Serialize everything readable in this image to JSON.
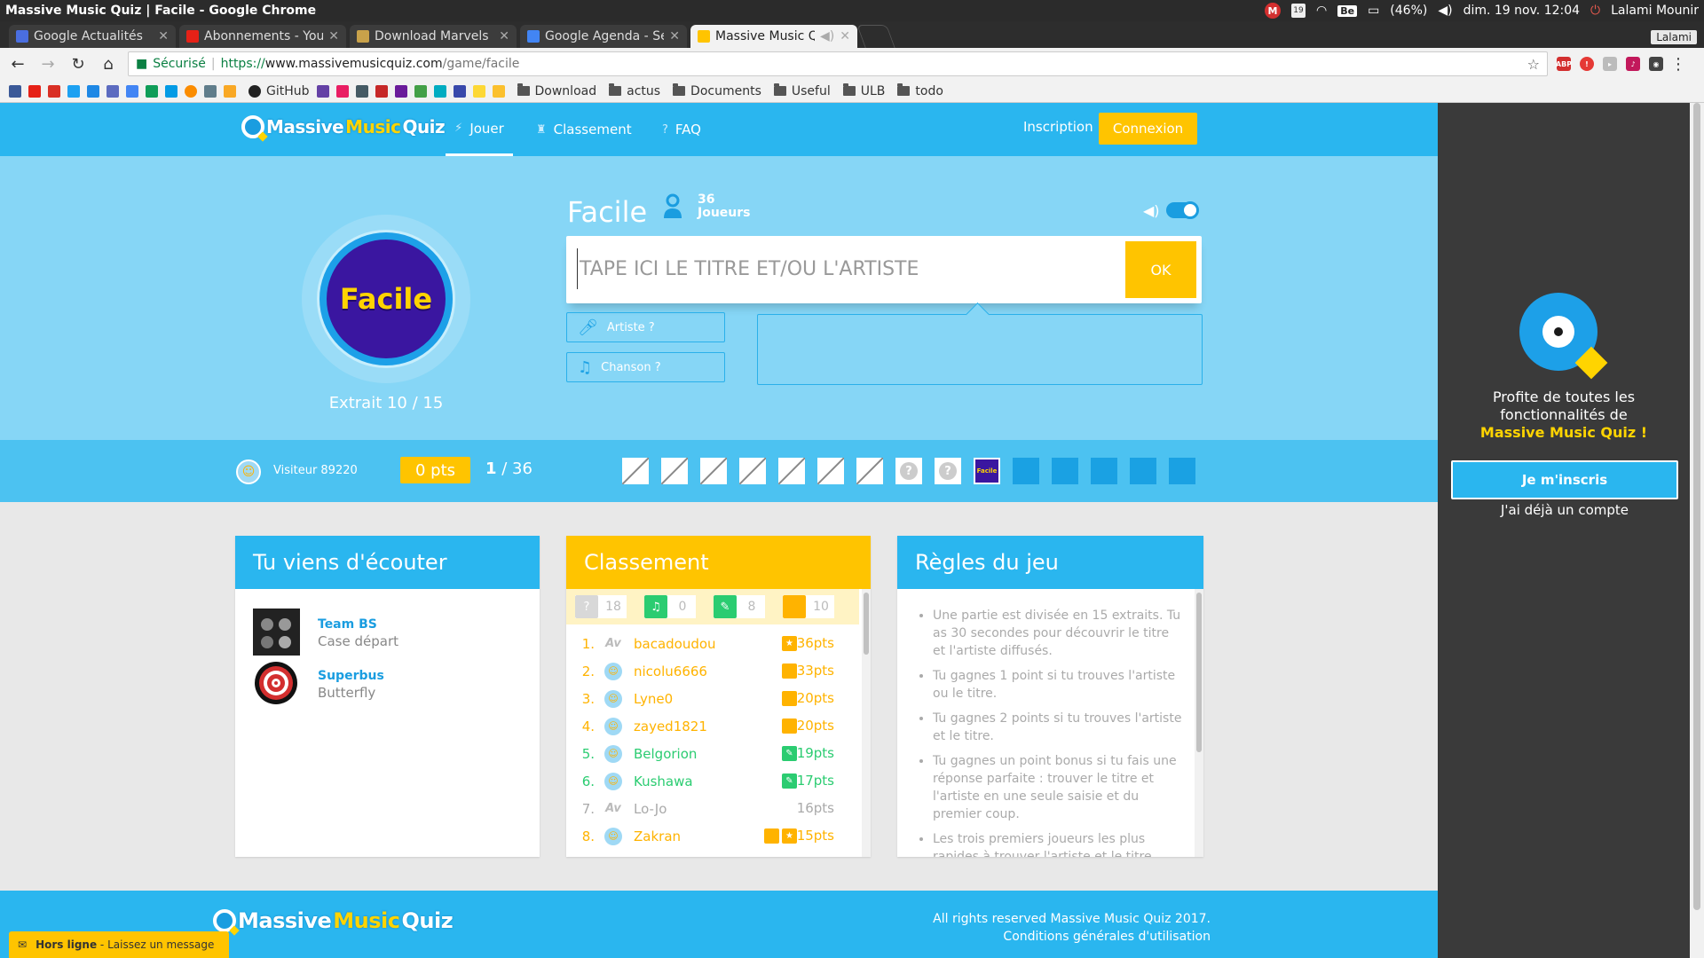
{
  "os_bar": {
    "window_title": "Massive Music Quiz | Facile - Google Chrome",
    "mail_badge": "M",
    "calendar_day": "19",
    "keyboard_layout": "Be",
    "battery": "(46%)",
    "clock": "dim. 19 nov. 12:04",
    "user": "Lalami Mounir"
  },
  "tabs": [
    {
      "label": "Google Actualités",
      "icon": "google-news-icon",
      "color": "#4a6ee0"
    },
    {
      "label": "Abonnements - You",
      "icon": "youtube-icon",
      "color": "#e62117"
    },
    {
      "label": "Download Marvels",
      "icon": "shield-icon",
      "color": "#c9a24a"
    },
    {
      "label": "Google Agenda - Se",
      "icon": "calendar-icon",
      "color": "#4285f4"
    },
    {
      "label": "Massive Music Q",
      "icon": "mmq-icon",
      "color": "#ffc400",
      "active": true
    }
  ],
  "profile_name": "Lalami",
  "address": {
    "secure_label": "Sécurisé",
    "protocol": "https://",
    "host": "www.massivemusicquiz.com",
    "path": "/game/facile"
  },
  "bookmarks": {
    "github_label": "GitHub",
    "folders": [
      "Download",
      "actus",
      "Documents",
      "Useful",
      "ULB",
      "todo"
    ]
  },
  "site_nav": {
    "play": "Jouer",
    "ranking": "Classement",
    "faq": "FAQ",
    "signup": "Inscription",
    "login": "Connexion"
  },
  "logo": {
    "part1": "Massive",
    "part2": "Music",
    "part3": "Quiz"
  },
  "game": {
    "level": "Facile",
    "level_badge": "Facile",
    "extract_label": "Extrait 10 / 15",
    "players_count": "36",
    "players_label": "Joueurs",
    "answer_placeholder": "TAPE ICI LE TITRE ET/OU L'ARTISTE",
    "ok_label": "OK",
    "artist_hint": "Artiste ?",
    "song_hint": "Chanson ?",
    "sound_on": true
  },
  "score_bar": {
    "visitor_name": "Visiteur 89220",
    "points": "0 pts",
    "rank_current": "1",
    "rank_total": "/ 36",
    "extracts": [
      "done",
      "done",
      "done",
      "done",
      "done",
      "done",
      "done",
      "unknown",
      "unknown",
      "current",
      "todo",
      "todo",
      "todo",
      "todo",
      "todo"
    ],
    "current_label": "Facile"
  },
  "listen_card": {
    "title": "Tu viens d'écouter",
    "songs": [
      {
        "artist": "Team BS",
        "title": "Case départ"
      },
      {
        "artist": "Superbus",
        "title": "Butterfly"
      }
    ]
  },
  "ranking_card": {
    "title": "Classement",
    "stats": [
      {
        "icon": "question-icon",
        "value": "18",
        "color": "#d8d8d8"
      },
      {
        "icon": "music-note-icon",
        "value": "0",
        "color": "#2bcc71"
      },
      {
        "icon": "microphone-icon",
        "value": "8",
        "color": "#2bcc71"
      },
      {
        "icon": "square-icon",
        "value": "10",
        "color": "#ffb300"
      }
    ],
    "rows": [
      {
        "rank": "1.",
        "name": "bacadoudou",
        "pts": "36pts",
        "color": "orange",
        "avatar": "Av",
        "badges": [
          "star"
        ]
      },
      {
        "rank": "2.",
        "name": "nicolu6666",
        "pts": "33pts",
        "color": "orange",
        "avatar": "face",
        "badges": [
          "square"
        ]
      },
      {
        "rank": "3.",
        "name": "Lyne0",
        "pts": "20pts",
        "color": "orange",
        "avatar": "face",
        "badges": [
          "square"
        ]
      },
      {
        "rank": "4.",
        "name": "zayed1821",
        "pts": "20pts",
        "color": "orange",
        "avatar": "face",
        "badges": [
          "square"
        ]
      },
      {
        "rank": "5.",
        "name": "Belgorion",
        "pts": "19pts",
        "color": "green",
        "avatar": "face",
        "badges": [
          "mic"
        ]
      },
      {
        "rank": "6.",
        "name": "Kushawa",
        "pts": "17pts",
        "color": "green",
        "avatar": "face",
        "badges": [
          "mic"
        ]
      },
      {
        "rank": "7.",
        "name": "Lo-Jo",
        "pts": "16pts",
        "color": "grey",
        "avatar": "Av",
        "badges": []
      },
      {
        "rank": "8.",
        "name": "Zakran",
        "pts": "15pts",
        "color": "orange",
        "avatar": "face",
        "badges": [
          "square",
          "star"
        ]
      }
    ]
  },
  "rules_card": {
    "title": "Règles du jeu",
    "rules": [
      "Une partie est divisée en 15 extraits. Tu as 30 secondes pour découvrir le titre et l'artiste diffusés.",
      "Tu gagnes 1 point si tu trouves l'artiste ou le titre.",
      "Tu gagnes 2 points si tu trouves l'artiste et le titre.",
      "Tu gagnes un point bonus si tu fais une réponse parfaite : trouver le titre et l'artiste en une seule saisie et du premier coup.",
      "Les trois premiers joueurs les plus rapides à trouver l'artiste et le titre"
    ]
  },
  "footer": {
    "rights": "All rights reserved Massive Music Quiz 2017.",
    "terms": "Conditions générales d'utilisation"
  },
  "chat": {
    "status": "Hors ligne",
    "action": "- Laissez un message"
  },
  "sidebar": {
    "line1": "Profite de toutes les",
    "line2": "fonctionnalités de",
    "brand": "Massive Music Quiz !",
    "signup": "Je m'inscris",
    "have_account": "J'ai déjà un compte"
  }
}
